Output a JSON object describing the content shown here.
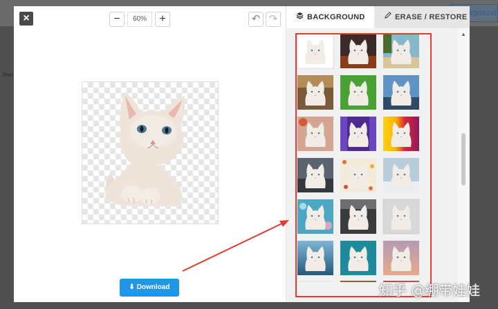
{
  "background_page": {
    "button_label": "Background",
    "side_text": "Ren"
  },
  "editor": {
    "close_label": "×",
    "zoom": {
      "minus_label": "−",
      "value": "60%",
      "plus_label": "+"
    },
    "undo_label": "↶",
    "redo_label": "↷",
    "download_label": "Download"
  },
  "panel": {
    "tabs": [
      {
        "label": "BACKGROUND",
        "icon": "layers-icon",
        "active": true
      },
      {
        "label": "ERASE / RESTORE",
        "icon": "pencil-icon",
        "active": false
      }
    ]
  },
  "thumbnails": [
    "plain-white",
    "dark-red-night",
    "beach-palm",
    "autumn-field",
    "green-grass",
    "city-skyline",
    "fruit-pink",
    "purple-curtain",
    "colorful-stripes",
    "dark-road",
    "flower-pattern",
    "snow-city",
    "bokeh-blue",
    "dark-room",
    "gray-gradient",
    "lake-blue",
    "teal-water",
    "purple-sunset",
    "white-partial",
    "wood-partial",
    "red-partial"
  ],
  "annotation": {
    "color": "#e23b30",
    "watermark": "知乎 @绷带娃娃"
  }
}
